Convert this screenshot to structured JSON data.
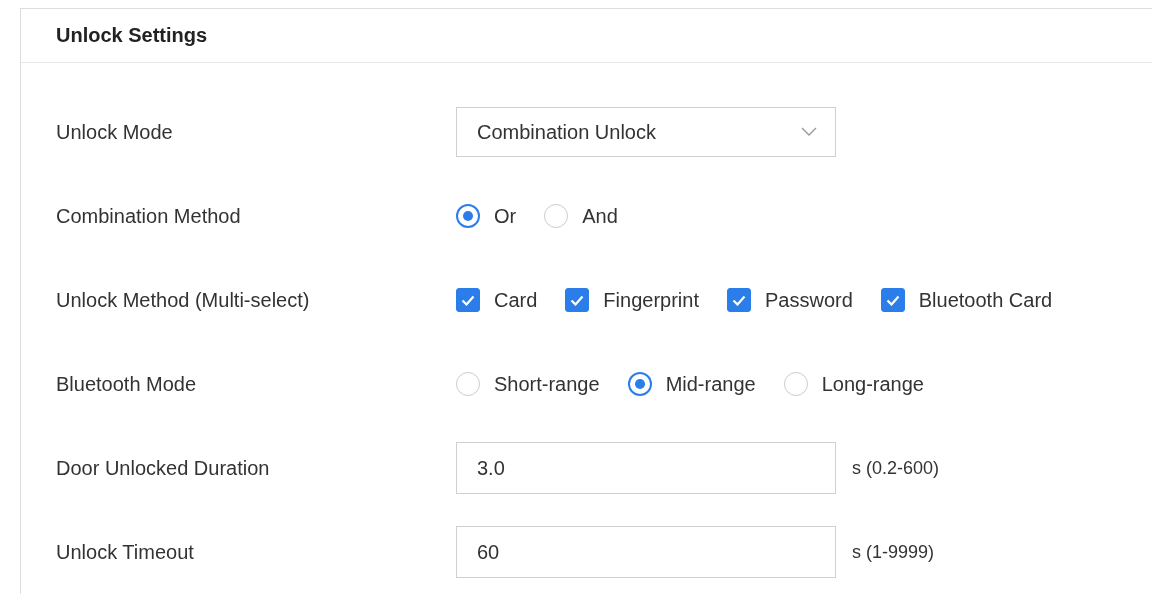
{
  "section": {
    "title": "Unlock Settings"
  },
  "fields": [
    {
      "kind": "select",
      "label": "Unlock Mode",
      "value": "Combination Unlock"
    },
    {
      "kind": "radio",
      "label": "Combination Method",
      "options": [
        {
          "label": "Or",
          "selected": true
        },
        {
          "label": "And",
          "selected": false
        }
      ]
    },
    {
      "kind": "checkbox",
      "label": "Unlock Method (Multi-select)",
      "options": [
        {
          "label": "Card",
          "checked": true
        },
        {
          "label": "Fingerprint",
          "checked": true
        },
        {
          "label": "Password",
          "checked": true
        },
        {
          "label": "Bluetooth Card",
          "checked": true
        }
      ]
    },
    {
      "kind": "radio",
      "label": "Bluetooth Mode",
      "options": [
        {
          "label": "Short-range",
          "selected": false
        },
        {
          "label": "Mid-range",
          "selected": true
        },
        {
          "label": "Long-range",
          "selected": false
        }
      ]
    },
    {
      "kind": "input",
      "label": "Door Unlocked Duration",
      "value": "3.0",
      "unit": "s (0.2-600)"
    },
    {
      "kind": "input",
      "label": "Unlock Timeout",
      "value": "60",
      "unit": "s (1-9999)"
    }
  ]
}
